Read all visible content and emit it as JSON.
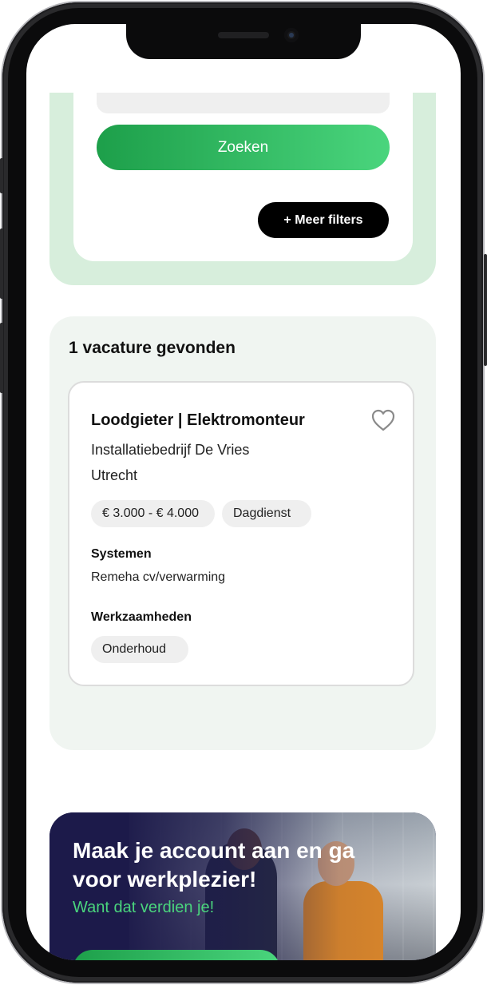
{
  "search": {
    "submit_label": "Zoeken",
    "more_filters_label": "+ Meer filters"
  },
  "results": {
    "count_label": "1 vacature gevonden",
    "jobs": [
      {
        "title": "Loodgieter | Elektromonteur",
        "company": "Installatiebedrijf De Vries",
        "location": "Utrecht",
        "salary": "€ 3.000 - € 4.000",
        "shift": "Dagdienst",
        "systems_label": "Systemen",
        "systems_value": "Remeha cv/verwarming",
        "tasks_label": "Werkzaamheden",
        "tasks": [
          "Onderhoud"
        ]
      }
    ]
  },
  "promo": {
    "title": "Maak je account aan en ga voor werkplezier!",
    "subtitle": "Want dat verdien je!"
  },
  "colors": {
    "accent_green": "#2bb35e",
    "panel_green": "#d7eedc",
    "results_bg": "#f0f5f1",
    "promo_bg": "#1c1a4a"
  },
  "icons": {
    "favorite": "heart-outline-icon"
  }
}
